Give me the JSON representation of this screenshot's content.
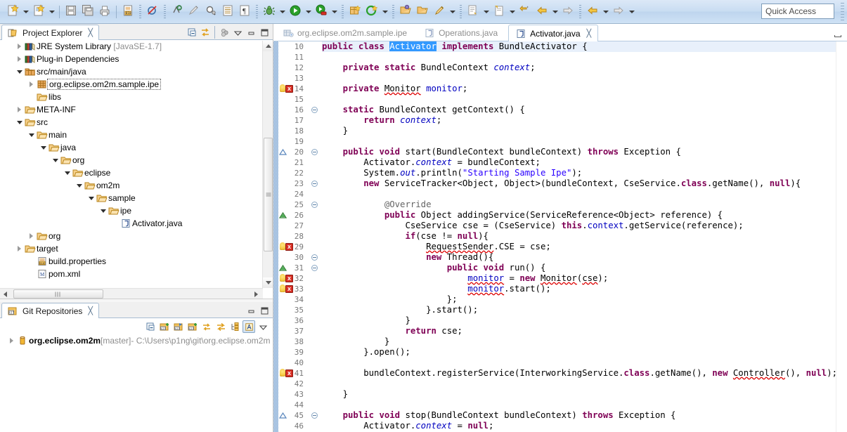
{
  "toolbar": {
    "groups": [
      {
        "items": [
          {
            "name": "new-wizard-button",
            "icon": "new-file-icon",
            "arrow": true
          },
          {
            "name": "new-java-class-button",
            "icon": "new-class-icon",
            "arrow": true
          }
        ]
      },
      {
        "items": [
          {
            "name": "save-button",
            "icon": "save-icon",
            "arrow": false
          },
          {
            "name": "save-all-button",
            "icon": "save-all-icon",
            "arrow": false
          },
          {
            "name": "print-button",
            "icon": "print-icon",
            "arrow": false
          }
        ],
        "sep": "line"
      },
      {
        "items": [
          {
            "name": "build-properties-button",
            "icon": "binary-file-icon",
            "arrow": false
          }
        ],
        "sep": "line"
      },
      {
        "items": [
          {
            "name": "skip-all-breakpoints-button",
            "icon": "breakpoint-skip-icon",
            "arrow": false
          }
        ],
        "sep": "dots"
      },
      {
        "items": [
          {
            "name": "new-class-wizard-button",
            "icon": "class-c-icon",
            "arrow": false
          },
          {
            "name": "new-package-button",
            "icon": "pen-icon",
            "arrow": false
          },
          {
            "name": "search-button",
            "icon": "search-magnifier-icon",
            "arrow": false
          },
          {
            "name": "open-task-button",
            "icon": "task-list-icon",
            "arrow": false
          },
          {
            "name": "paragraph-button",
            "icon": "pilcrow-icon",
            "arrow": false
          }
        ],
        "sep": "dots"
      },
      {
        "items": [
          {
            "name": "debug-button",
            "icon": "debug-bug-icon",
            "arrow": true
          },
          {
            "name": "run-button",
            "icon": "run-play-icon",
            "arrow": true
          },
          {
            "name": "run-external-tools-button",
            "icon": "external-tools-icon",
            "arrow": true
          }
        ],
        "sep": "dots"
      },
      {
        "items": [
          {
            "name": "new-plugin-project-button",
            "icon": "package-new-icon",
            "arrow": false
          },
          {
            "name": "coverage-button",
            "icon": "coverage-icon",
            "arrow": true
          }
        ],
        "sep": "dots"
      },
      {
        "items": [
          {
            "name": "open-type-button",
            "icon": "open-type-icon",
            "arrow": false
          },
          {
            "name": "open-resource-button",
            "icon": "open-folder-icon",
            "arrow": false
          },
          {
            "name": "new-annotation-button",
            "icon": "brush-icon",
            "arrow": true
          }
        ],
        "sep": "dots"
      },
      {
        "items": [
          {
            "name": "next-annotation-button",
            "icon": "next-annotation-icon",
            "arrow": true
          },
          {
            "name": "previous-annotation-button",
            "icon": "previous-annotation-icon",
            "arrow": true
          }
        ],
        "sep": "dots"
      },
      {
        "items": [
          {
            "name": "last-edit-location-button",
            "icon": "last-edit-icon",
            "arrow": false
          },
          {
            "name": "back-button",
            "icon": "back-arrow-icon",
            "arrow": true
          },
          {
            "name": "forward-button",
            "icon": "forward-arrow-icon",
            "arrow": false
          }
        ]
      },
      {
        "items": [
          {
            "name": "back-history-button",
            "icon": "back-arrow-icon",
            "arrow": true
          },
          {
            "name": "forward-history-button",
            "icon": "forward-arrow-icon",
            "arrow": true
          }
        ],
        "sep": "dots"
      }
    ],
    "quick_access_placeholder": "Quick Access"
  },
  "project_explorer": {
    "tab_label": "Project Explorer",
    "tab_icon": "project-explorer-icon",
    "close_glyph": "╳",
    "toolbar": [
      {
        "name": "collapse-all-button",
        "icon": "collapse-all-icon"
      },
      {
        "name": "link-with-editor-button",
        "icon": "link-editor-icon"
      },
      {
        "name": "view-menu-filter-button",
        "icon": "filter-icon"
      },
      {
        "name": "view-menu-button",
        "icon": "chevron-down-icon"
      },
      {
        "name": "minimize-button",
        "icon": "minimize-icon"
      },
      {
        "name": "maximize-button",
        "icon": "maximize-icon"
      }
    ],
    "tree": [
      {
        "indent": 1,
        "twist": "closed",
        "icon": "jre-library-icon",
        "label": "JRE System Library",
        "suffix": "[JavaSE-1.7]"
      },
      {
        "indent": 1,
        "twist": "closed",
        "icon": "jre-library-icon",
        "label": "Plug-in Dependencies",
        "suffix": ""
      },
      {
        "indent": 1,
        "twist": "open",
        "icon": "source-folder-icon",
        "label": "src/main/java",
        "suffix": ""
      },
      {
        "indent": 2,
        "twist": "closed",
        "icon": "package-icon",
        "label": "org.eclipse.om2m.sample.ipe",
        "suffix": "",
        "selected": true
      },
      {
        "indent": 2,
        "twist": "none",
        "icon": "folder-icon",
        "label": "libs",
        "suffix": ""
      },
      {
        "indent": 1,
        "twist": "closed",
        "icon": "folder-icon",
        "label": "META-INF",
        "suffix": ""
      },
      {
        "indent": 1,
        "twist": "open",
        "icon": "folder-icon",
        "label": "src",
        "suffix": ""
      },
      {
        "indent": 2,
        "twist": "open",
        "icon": "folder-icon",
        "label": "main",
        "suffix": ""
      },
      {
        "indent": 3,
        "twist": "open",
        "icon": "folder-icon",
        "label": "java",
        "suffix": ""
      },
      {
        "indent": 4,
        "twist": "open",
        "icon": "folder-icon",
        "label": "org",
        "suffix": ""
      },
      {
        "indent": 5,
        "twist": "open",
        "icon": "folder-icon",
        "label": "eclipse",
        "suffix": ""
      },
      {
        "indent": 6,
        "twist": "open",
        "icon": "folder-icon",
        "label": "om2m",
        "suffix": ""
      },
      {
        "indent": 7,
        "twist": "open",
        "icon": "folder-icon",
        "label": "sample",
        "suffix": ""
      },
      {
        "indent": 8,
        "twist": "open",
        "icon": "folder-icon",
        "label": "ipe",
        "suffix": ""
      },
      {
        "indent": 9,
        "twist": "none",
        "icon": "java-file-icon",
        "label": "Activator.java",
        "suffix": ""
      },
      {
        "indent": 2,
        "twist": "closed",
        "icon": "folder-icon",
        "label": "org",
        "suffix": ""
      },
      {
        "indent": 1,
        "twist": "closed",
        "icon": "folder-icon",
        "label": "target",
        "suffix": ""
      },
      {
        "indent": 2,
        "twist": "none",
        "icon": "properties-file-icon",
        "label": "build.properties",
        "suffix": ""
      },
      {
        "indent": 2,
        "twist": "none",
        "icon": "maven-file-icon",
        "label": "pom.xml",
        "suffix": ""
      }
    ]
  },
  "git_repositories": {
    "tab_label": "Git Repositories",
    "tab_icon": "git-repositories-icon",
    "close_glyph": "╳",
    "toolbar": [
      {
        "name": "collapse-all-button",
        "icon": "collapse-all-icon"
      },
      {
        "name": "add-existing-repository-button",
        "icon": "git-add-icon"
      },
      {
        "name": "clone-repository-button",
        "icon": "git-clone-icon"
      },
      {
        "name": "create-repository-button",
        "icon": "git-create-icon"
      },
      {
        "name": "pull-button",
        "icon": "git-pull-icon"
      },
      {
        "name": "fetch-button",
        "icon": "git-fetch-icon"
      },
      {
        "name": "hierarchy-layout-button",
        "icon": "hierarchy-icon"
      },
      {
        "name": "link-with-selection-button",
        "icon": "link-selection-icon"
      },
      {
        "name": "view-menu-button",
        "icon": "chevron-down-icon"
      }
    ],
    "minimize_button": "minimize-icon",
    "maximize_button": "maximize-icon",
    "tree": [
      {
        "twist": "closed",
        "icon": "repository-icon",
        "label": "org.eclipse.om2m",
        "branch": "[master]",
        "path": "- C:\\Users\\p1ng\\git\\org.eclipse.om2m"
      }
    ]
  },
  "editor": {
    "tabs": [
      {
        "label": "org.eclipse.om2m.sample.ipe",
        "icon": "manifest-icon",
        "active": false,
        "closable": false
      },
      {
        "label": "Operations.java",
        "icon": "java-file-icon",
        "active": false,
        "closable": false
      },
      {
        "label": "Activator.java",
        "icon": "java-file-icon",
        "active": true,
        "closable": true
      }
    ],
    "close_glyph": "╳",
    "minimize_button": "minimize-icon",
    "first_line": 10,
    "lines": [
      {
        "n": 10,
        "fold": false,
        "marker": "none",
        "highlight": true,
        "html": "<span class=\"kw\">public</span> <span class=\"kw\">class</span> <span class=\"sel\">Activator</span> <span class=\"kw\">implements</span> BundleActivator {"
      },
      {
        "n": 11,
        "fold": false,
        "marker": "none",
        "highlight": false,
        "html": ""
      },
      {
        "n": 12,
        "fold": false,
        "marker": "none",
        "highlight": false,
        "html": "    <span class=\"kw\">private</span> <span class=\"kw\">static</span> BundleContext <span class=\"fld\">context</span>;"
      },
      {
        "n": 13,
        "fold": false,
        "marker": "none",
        "highlight": false,
        "html": ""
      },
      {
        "n": 14,
        "fold": false,
        "marker": "error",
        "highlight": false,
        "html": "    <span class=\"kw\">private</span> <span class=\"erru\">Monitor</span> <span class=\"fldn\">monitor</span>;"
      },
      {
        "n": 15,
        "fold": false,
        "marker": "none",
        "highlight": false,
        "html": ""
      },
      {
        "n": 16,
        "fold": true,
        "marker": "none",
        "highlight": false,
        "html": "    <span class=\"kw\">static</span> BundleContext getContext() {"
      },
      {
        "n": 17,
        "fold": false,
        "marker": "none",
        "highlight": false,
        "html": "        <span class=\"kw\">return</span> <span class=\"fld\">context</span>;"
      },
      {
        "n": 18,
        "fold": false,
        "marker": "none",
        "highlight": false,
        "html": "    }"
      },
      {
        "n": 19,
        "fold": false,
        "marker": "none",
        "highlight": false,
        "html": ""
      },
      {
        "n": 20,
        "fold": true,
        "marker": "impl",
        "highlight": false,
        "html": "    <span class=\"kw\">public</span> <span class=\"kw\">void</span> start(BundleContext bundleContext) <span class=\"kw\">throws</span> Exception {"
      },
      {
        "n": 21,
        "fold": false,
        "marker": "none",
        "highlight": false,
        "html": "        Activator.<span class=\"fld\">context</span> = bundleContext;"
      },
      {
        "n": 22,
        "fold": false,
        "marker": "none",
        "highlight": false,
        "html": "        System.<span class=\"fld\">out</span>.println(<span class=\"str\">\"Starting Sample Ipe\"</span>);"
      },
      {
        "n": 23,
        "fold": true,
        "marker": "none",
        "highlight": false,
        "html": "        <span class=\"kw\">new</span> ServiceTracker&lt;Object, Object&gt;(bundleContext, CseService.<span class=\"kw\">class</span>.getName(), <span class=\"kw\">null</span>){"
      },
      {
        "n": 24,
        "fold": false,
        "marker": "none",
        "highlight": false,
        "html": ""
      },
      {
        "n": 25,
        "fold": true,
        "marker": "none",
        "highlight": false,
        "html": "            <span class=\"ann\">@Override</span>"
      },
      {
        "n": 26,
        "fold": false,
        "marker": "ovr",
        "highlight": false,
        "html": "            <span class=\"kw\">public</span> Object addingService(ServiceReference&lt;Object&gt; reference) {"
      },
      {
        "n": 27,
        "fold": false,
        "marker": "none",
        "highlight": false,
        "html": "                CseService cse = (CseService) <span class=\"kw\">this</span>.<span class=\"fldn\">context</span>.getService(reference);"
      },
      {
        "n": 28,
        "fold": false,
        "marker": "none",
        "highlight": false,
        "html": "                <span class=\"kw\">if</span>(cse != <span class=\"kw\">null</span>){"
      },
      {
        "n": 29,
        "fold": false,
        "marker": "error",
        "highlight": false,
        "html": "                    <span class=\"erru\">RequestSender</span>.CSE = cse;"
      },
      {
        "n": 30,
        "fold": true,
        "marker": "none",
        "highlight": false,
        "html": "                    <span class=\"kw\">new</span> Thread(){"
      },
      {
        "n": 31,
        "fold": true,
        "marker": "ovr",
        "highlight": false,
        "html": "                        <span class=\"kw\">public</span> <span class=\"kw\">void</span> run() {"
      },
      {
        "n": 32,
        "fold": false,
        "marker": "error",
        "highlight": false,
        "html": "                            <span class=\"erru fldn\">monitor</span> = <span class=\"kw\">new</span> <span class=\"erru\">Monitor</span>(<span class=\"erru\">cse</span>);"
      },
      {
        "n": 33,
        "fold": false,
        "marker": "error",
        "highlight": false,
        "html": "                            <span class=\"erru fldn\">monitor</span>.start();"
      },
      {
        "n": 34,
        "fold": false,
        "marker": "none",
        "highlight": false,
        "html": "                        };"
      },
      {
        "n": 35,
        "fold": false,
        "marker": "none",
        "highlight": false,
        "html": "                    }.start();"
      },
      {
        "n": 36,
        "fold": false,
        "marker": "none",
        "highlight": false,
        "html": "                }"
      },
      {
        "n": 37,
        "fold": false,
        "marker": "none",
        "highlight": false,
        "html": "                <span class=\"kw\">return</span> cse;"
      },
      {
        "n": 38,
        "fold": false,
        "marker": "none",
        "highlight": false,
        "html": "            }"
      },
      {
        "n": 39,
        "fold": false,
        "marker": "none",
        "highlight": false,
        "html": "        }.open();"
      },
      {
        "n": 40,
        "fold": false,
        "marker": "none",
        "highlight": false,
        "html": ""
      },
      {
        "n": 41,
        "fold": false,
        "marker": "error",
        "highlight": false,
        "html": "        bundleContext.registerService(InterworkingService.<span class=\"kw\">class</span>.getName(), <span class=\"kw\">new</span> <span class=\"erru\">Controller</span>(), <span class=\"kw\">null</span>);"
      },
      {
        "n": 42,
        "fold": false,
        "marker": "none",
        "highlight": false,
        "html": ""
      },
      {
        "n": 43,
        "fold": false,
        "marker": "none",
        "highlight": false,
        "html": "    }"
      },
      {
        "n": 44,
        "fold": false,
        "marker": "none",
        "highlight": false,
        "html": ""
      },
      {
        "n": 45,
        "fold": true,
        "marker": "impl",
        "highlight": false,
        "html": "    <span class=\"kw\">public</span> <span class=\"kw\">void</span> stop(BundleContext bundleContext) <span class=\"kw\">throws</span> Exception {"
      },
      {
        "n": 46,
        "fold": false,
        "marker": "none",
        "highlight": false,
        "html": "        Activator.<span class=\"fld\">context</span> = <span class=\"kw\">null</span>;"
      }
    ]
  },
  "colors": {
    "toolbar_bg": "#c9ddf2",
    "keyword": "#7f0055",
    "string": "#2a00ff",
    "field": "#0000c0",
    "annotation": "#646464",
    "selection": "#3399ff",
    "current_line": "#e8f0fb",
    "changebar": "#7ba3d0",
    "error_marker": "#d93025"
  }
}
